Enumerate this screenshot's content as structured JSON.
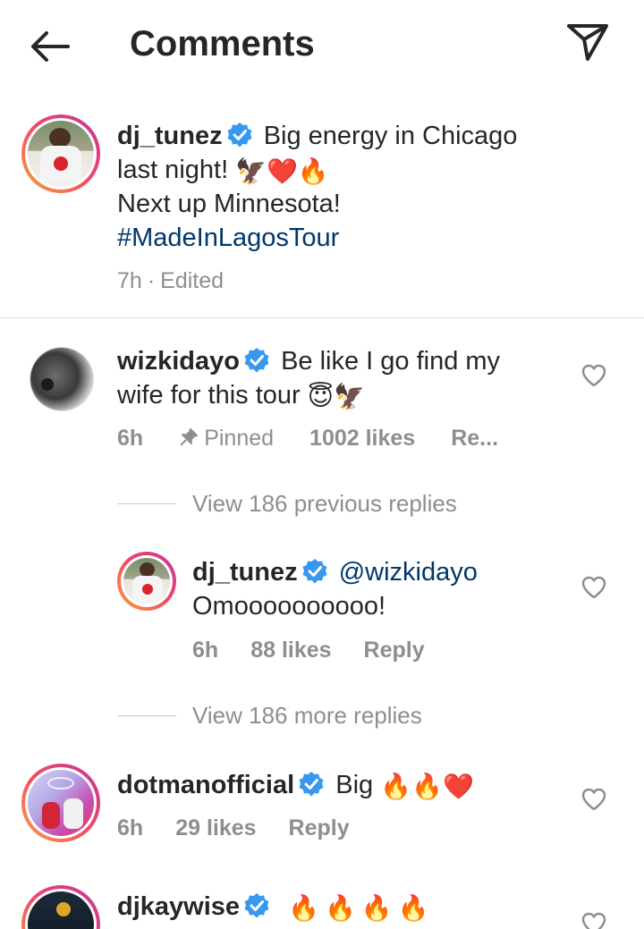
{
  "header": {
    "title": "Comments"
  },
  "caption": {
    "username": "dj_tunez",
    "text_line1": "Big energy in Chicago",
    "text_line2": "last night!",
    "emojis_line2": "🦅❤️🔥",
    "text_line3": "Next up Minnesota!",
    "hashtag": "#MadeInLagosTour",
    "time": "7h",
    "separator": "·",
    "edited": "Edited"
  },
  "comments": [
    {
      "username": "wizkidayo",
      "text_line1": "Be like I go find my",
      "text_line2": "wife for this tour",
      "emojis": "😇🦅",
      "time": "6h",
      "pinned": "Pinned",
      "likes": "1002 likes",
      "reply": "Re..."
    },
    {
      "view_previous": "View 186 previous replies"
    },
    {
      "username": "dj_tunez",
      "mention": "@wizkidayo",
      "text": "Omoooooooooo!",
      "time": "6h",
      "likes": "88 likes",
      "reply": "Reply"
    },
    {
      "view_more": "View 186 more replies"
    },
    {
      "username": "dotmanofficial",
      "text": "Big",
      "emojis": "🔥🔥❤️",
      "time": "6h",
      "likes": "29 likes",
      "reply": "Reply"
    },
    {
      "username": "djkaywise",
      "emojis": "🔥🔥🔥🔥"
    }
  ],
  "colors": {
    "verified": "#3897f0",
    "hashtag": "#00376b",
    "meta": "#8e8e8e",
    "heart": "#8e8e8e"
  }
}
